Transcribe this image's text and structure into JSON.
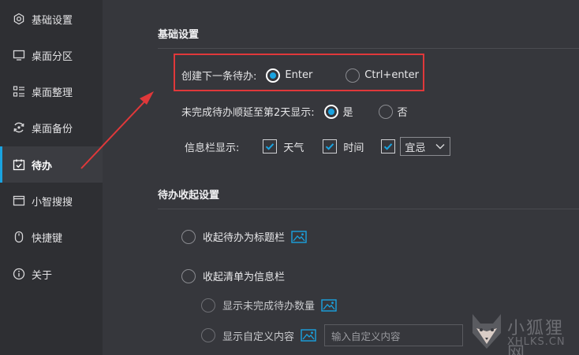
{
  "sidebar": {
    "items": [
      {
        "label": "基础设置",
        "icon": "gear-icon"
      },
      {
        "label": "桌面分区",
        "icon": "monitor-icon"
      },
      {
        "label": "桌面整理",
        "icon": "list-icon"
      },
      {
        "label": "桌面备份",
        "icon": "backup-icon"
      },
      {
        "label": "待办",
        "icon": "calendar-check-icon",
        "active": true
      },
      {
        "label": "小智搜搜",
        "icon": "window-icon"
      },
      {
        "label": "快捷键",
        "icon": "mouse-icon"
      },
      {
        "label": "关于",
        "icon": "info-icon"
      }
    ]
  },
  "basic": {
    "title": "基础设置",
    "create_next_label": "创建下一条待办:",
    "create_next_options": [
      "Enter",
      "Ctrl+enter"
    ],
    "create_next_selected": "Enter",
    "postpone_label": "未完成待办顺延至第2天显示:",
    "postpone_options": [
      "是",
      "否"
    ],
    "postpone_selected": "是",
    "infobar_label": "信息栏显示:",
    "infobar_weather": "天气",
    "infobar_time": "时间",
    "infobar_select_value": "宜忌"
  },
  "collapse": {
    "title": "待办收起设置",
    "option_titlebar": "收起待办为标题栏",
    "option_infobar": "收起清单为信息栏",
    "sub_show_count": "显示未完成待办数量",
    "sub_custom": "显示自定义内容",
    "custom_placeholder": "输入自定义内容"
  },
  "watermark": {
    "cn": "小狐狸网",
    "en": "XHLKS.CN"
  },
  "colors": {
    "accent": "#1aa3e0",
    "highlight": "#e0383a",
    "bg": "#36373c",
    "sidebar": "#2e2f33"
  }
}
